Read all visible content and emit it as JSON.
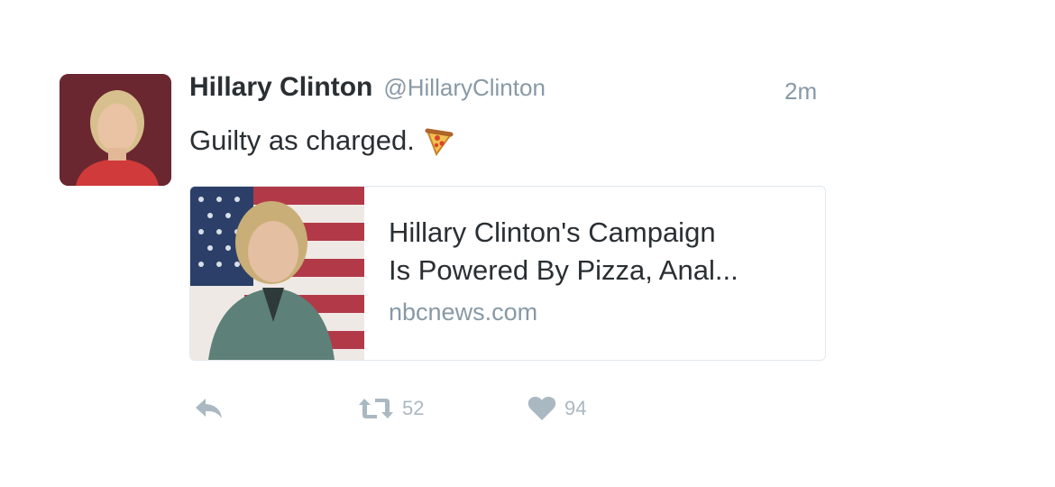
{
  "tweet": {
    "author_name": "Hillary Clinton",
    "author_handle": "@HillaryClinton",
    "timestamp": "2m",
    "text": "Guilty as charged.",
    "emoji_icon": "pizza-icon",
    "avatar_icon": "profile-photo",
    "card": {
      "title": "Hillary Clinton's Campaign\nIs Powered By Pizza, Anal...",
      "domain": "nbcnews.com",
      "image_icon": "article-thumbnail"
    },
    "actions": {
      "reply_icon": "reply-icon",
      "retweet_icon": "retweet-icon",
      "retweet_count": "52",
      "like_icon": "heart-icon",
      "like_count": "94"
    }
  },
  "colors": {
    "text_primary": "#292f33",
    "text_secondary": "#8899a6",
    "icon_muted": "#aab8c2",
    "card_border": "#e1e8ed"
  }
}
